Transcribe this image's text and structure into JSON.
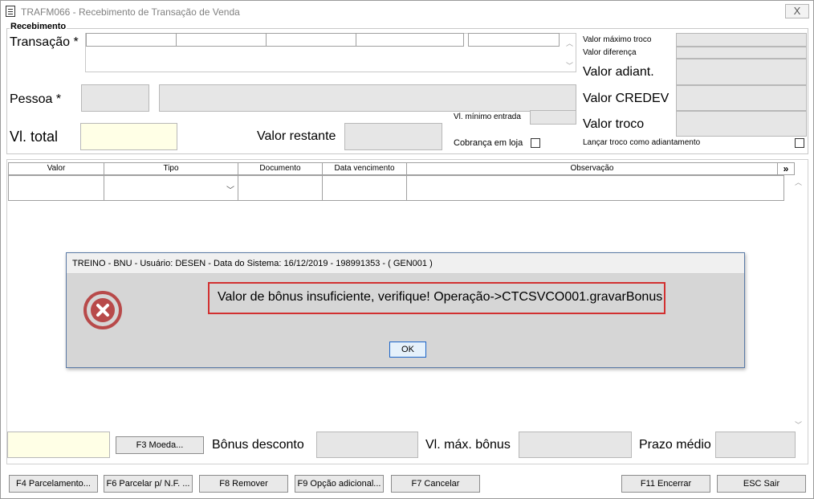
{
  "window": {
    "title": "TRAFM066 - Recebimento de Transação de Venda",
    "close_label": "X"
  },
  "recebimento": {
    "legend": "Recebimento",
    "transacao_label": "Transação *",
    "pessoa_label": "Pessoa *",
    "vl_total_label": "Vl. total",
    "valor_restante_label": "Valor restante",
    "vl_minimo_entrada_label": "Vl. mínimo entrada",
    "cobranca_em_loja_label": "Cobrança em loja",
    "valor_maximo_troco_label": "Valor máximo troco",
    "valor_diferenca_label": "Valor diferença",
    "valor_adiant_label": "Valor adiant.",
    "valor_credev_label": "Valor CREDEV",
    "valor_troco_label": "Valor troco",
    "lancar_troco_label": "Lançar troco como adiantamento"
  },
  "grid": {
    "columns": [
      "Valor",
      "Tipo",
      "Documento",
      "Data vencimento",
      "Observação"
    ],
    "more_label": "»"
  },
  "bottom": {
    "f3_label": "F3 Moeda...",
    "bonus_desconto_label": "Bônus desconto",
    "vl_max_bonus_label": "Vl. máx. bônus",
    "prazo_medio_label": "Prazo médio"
  },
  "buttons": {
    "f4": "F4 Parcelamento...",
    "f6": "F6 Parcelar p/ N.F. ...",
    "f8": "F8 Remover",
    "f9": "F9 Opção adicional...",
    "f7": "F7 Cancelar",
    "f11": "F11 Encerrar",
    "esc": "ESC Sair"
  },
  "dialog": {
    "title": "TREINO - BNU - Usuário: DESEN - Data do Sistema: 16/12/2019 - 198991353 - ( GEN001 )",
    "message": "Valor de bônus insuficiente, verifique! Operação->CTCSVCO001.gravarBonus",
    "ok_label": "OK",
    "icon": "error-icon",
    "icon_color": "#b84a4a",
    "highlight_color": "#d23030"
  }
}
